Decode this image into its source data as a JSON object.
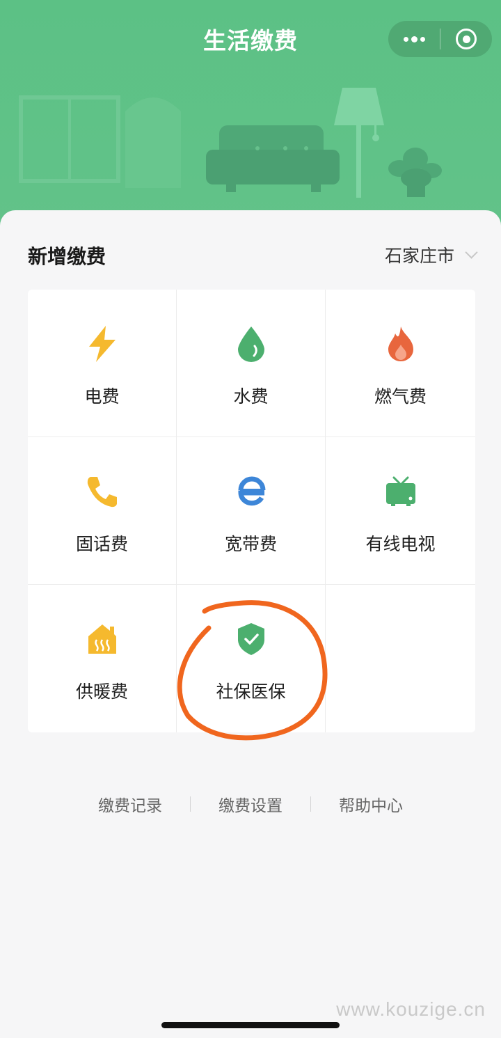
{
  "header": {
    "title": "生活缴费",
    "menu_icon": "more-dots-icon",
    "close_icon": "target-close-icon"
  },
  "section": {
    "title": "新增缴费",
    "city": "石家庄市"
  },
  "tiles": [
    {
      "label": "电费",
      "icon": "lightning-icon",
      "color": "#f5b92e"
    },
    {
      "label": "水费",
      "icon": "water-drop-icon",
      "color": "#4caf6e"
    },
    {
      "label": "燃气费",
      "icon": "flame-icon",
      "color": "#e8663d"
    },
    {
      "label": "固话费",
      "icon": "phone-icon",
      "color": "#f5b92e"
    },
    {
      "label": "宽带费",
      "icon": "broadband-e-icon",
      "color": "#3d86d8"
    },
    {
      "label": "有线电视",
      "icon": "tv-icon",
      "color": "#4caf6e"
    },
    {
      "label": "供暖费",
      "icon": "heating-house-icon",
      "color": "#f5b92e"
    },
    {
      "label": "社保医保",
      "icon": "shield-check-icon",
      "color": "#4caf6e"
    }
  ],
  "links": [
    "缴费记录",
    "缴费设置",
    "帮助中心"
  ],
  "watermark": "www.kouzige.cn",
  "colors": {
    "header_green": "#5cc185",
    "annotation_orange": "#f0661e"
  }
}
